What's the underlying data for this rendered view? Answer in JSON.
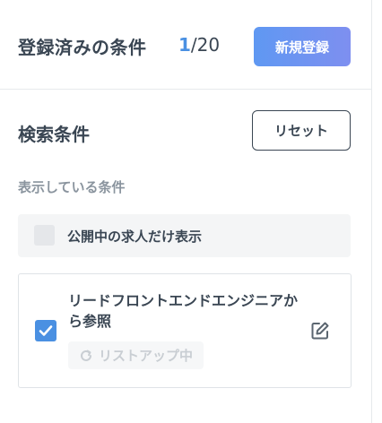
{
  "saved": {
    "title": "登録済みの条件",
    "count_current": "1",
    "count_separator": "/",
    "count_total": "20",
    "new_button_label": "新規登録"
  },
  "search": {
    "title": "検索条件",
    "reset_button_label": "リセット",
    "displayed_label": "表示している条件",
    "public_only_label": "公開中の求人だけ表示",
    "public_only_checked": false
  },
  "conditions": [
    {
      "name": "リードフロントエンドエンジニアから参照",
      "checked": true,
      "status": "リストアップ中"
    }
  ],
  "colors": {
    "accent": "#4a90e2",
    "button_gradient_start": "#5f98f2",
    "button_gradient_end": "#7e8ff0",
    "text_primary": "#3a4653",
    "text_muted": "#8a949e",
    "status_text": "#c9ced3"
  },
  "icons": {
    "checkbox_checked": "check-icon",
    "edit": "edit-icon",
    "status": "refresh-icon"
  }
}
